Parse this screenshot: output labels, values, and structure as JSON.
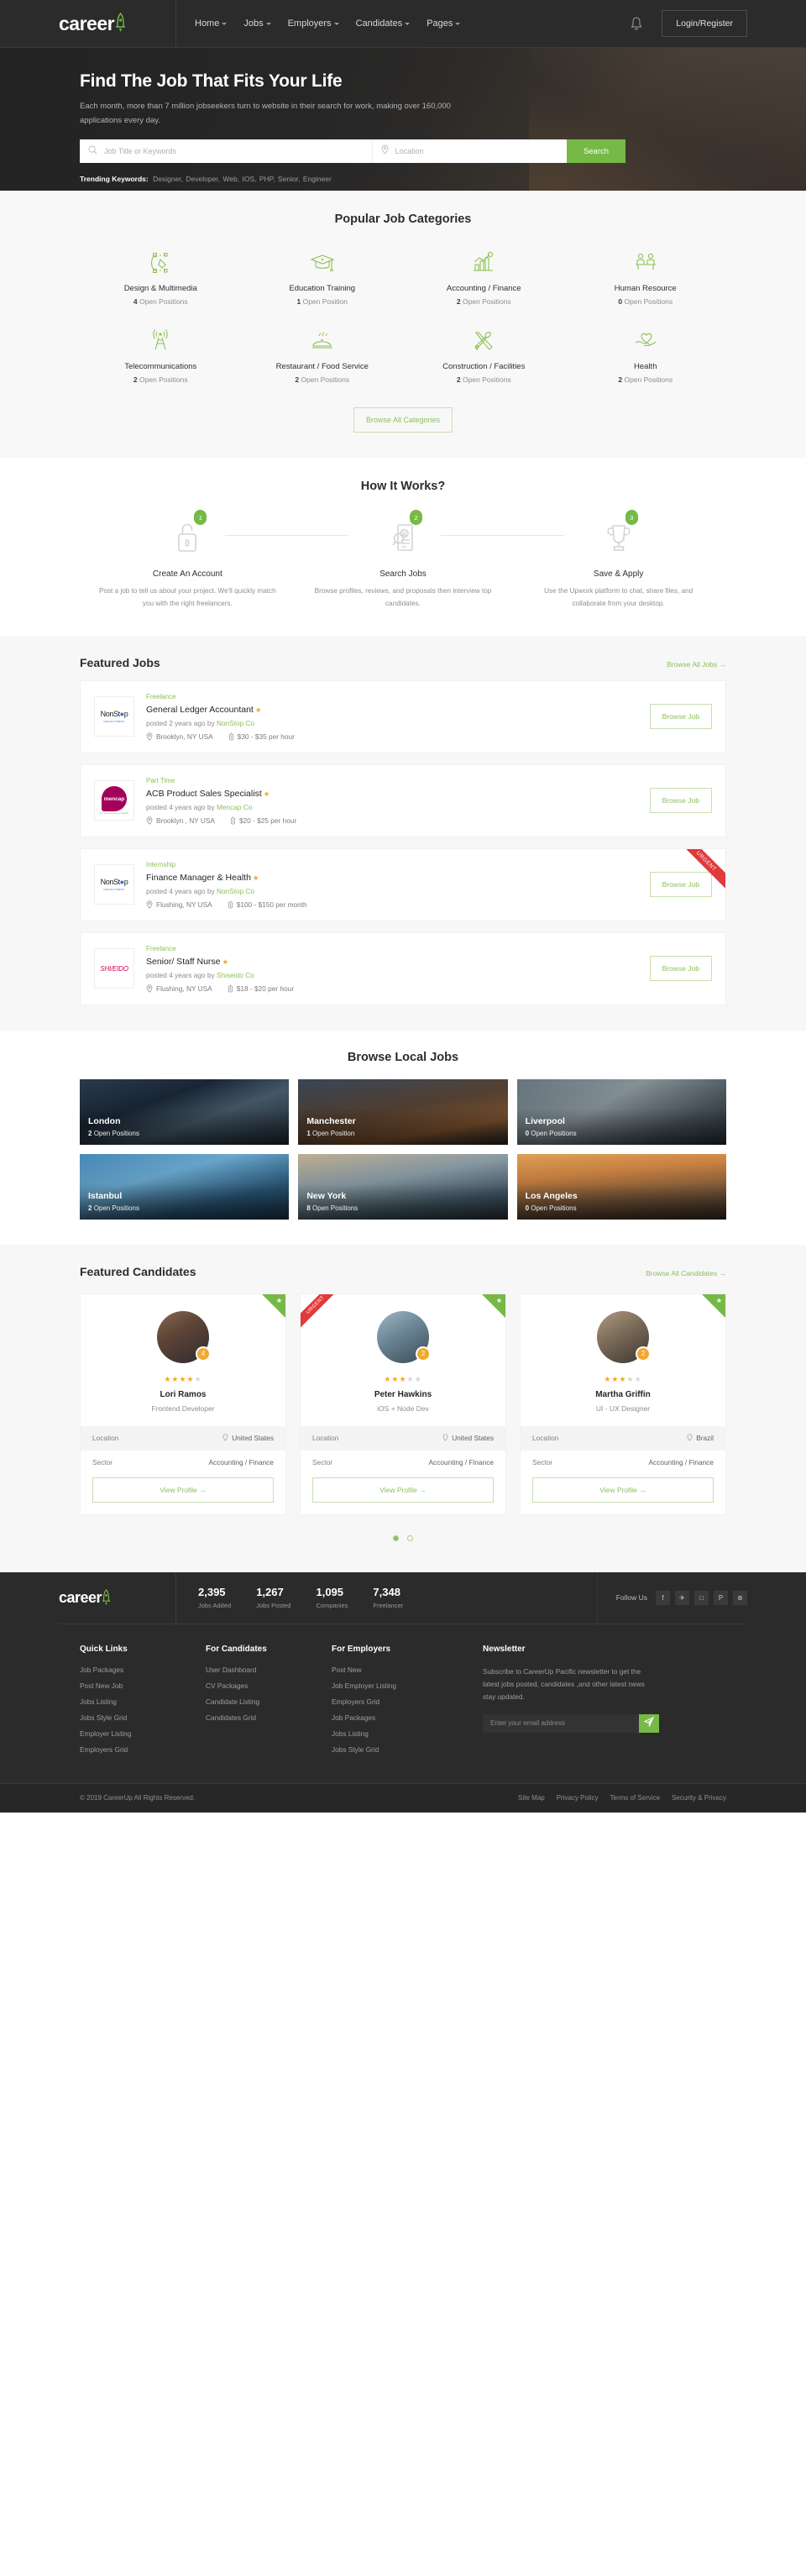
{
  "brand": {
    "name": "careerup",
    "name_part1": "career",
    "name_part2": "up"
  },
  "header": {
    "nav": [
      {
        "label": "Home",
        "has_caret": true
      },
      {
        "label": "Jobs",
        "has_caret": true
      },
      {
        "label": "Employers",
        "has_caret": true
      },
      {
        "label": "Candidates",
        "has_caret": true
      },
      {
        "label": "Pages",
        "has_caret": true
      }
    ],
    "notification_icon": "bell-icon",
    "login_label": "Login/Register"
  },
  "hero": {
    "title": "Find The Job That Fits Your Life",
    "subtitle": "Each month, more than 7 million jobseekers turn to website in their search for work, making over 160,000 applications every day.",
    "keyword_placeholder": "Job Title or Keywords",
    "location_placeholder": "Location",
    "search_label": "Search",
    "trending_label": "Trending Keywords:",
    "trending": [
      "Designer,",
      "Developer,",
      "Web,",
      "IOS,",
      "PHP,",
      "Senior,",
      "Engineer"
    ]
  },
  "categories": {
    "title": "Popular Job Categories",
    "browse_label": "Browse All Categories",
    "items": [
      {
        "name": "Design & Multimedia",
        "count": "4",
        "count_label": "Open Positions",
        "icon": "pen-tool-icon"
      },
      {
        "name": "Education Training",
        "count": "1",
        "count_label": "Open Position",
        "icon": "graduation-cap-icon"
      },
      {
        "name": "Accounting / Finance",
        "count": "2",
        "count_label": "Open Positions",
        "icon": "bar-chart-icon"
      },
      {
        "name": "Human Resource",
        "count": "0",
        "count_label": "Open Positions",
        "icon": "people-desk-icon"
      },
      {
        "name": "Telecommunications",
        "count": "2",
        "count_label": "Open Positions",
        "icon": "antenna-tower-icon"
      },
      {
        "name": "Restaurant / Food Service",
        "count": "2",
        "count_label": "Open Positions",
        "icon": "food-cloche-icon"
      },
      {
        "name": "Construction / Facilities",
        "count": "2",
        "count_label": "Open Positions",
        "icon": "tools-icon"
      },
      {
        "name": "Health",
        "count": "2",
        "count_label": "Open Positions",
        "icon": "hand-heart-icon"
      }
    ]
  },
  "how_it_works": {
    "title": "How It Works?",
    "steps": [
      {
        "num": "1",
        "name": "Create An Account",
        "desc": "Post a job to tell us about your project. We'll quickly match you with the right freelancers.",
        "icon": "lock-icon"
      },
      {
        "num": "2",
        "name": "Search Jobs",
        "desc": "Browse profiles, reviews, and proposals then interview top candidates.",
        "icon": "resume-search-icon"
      },
      {
        "num": "3",
        "name": "Save & Apply",
        "desc": "Use the Upwork platform to chat, share files, and collaborate from your desktop.",
        "icon": "trophy-icon"
      }
    ]
  },
  "featured_jobs": {
    "title": "Featured Jobs",
    "more_label": "Browse All Jobs",
    "browse_job_label": "Browse Job",
    "urgent_label": "URGENT",
    "items": [
      {
        "logo_text": "NonStop",
        "logo_sub": "RECRUITMENT",
        "type": "Freelance",
        "title": "General Ledger Accountant",
        "posted": "posted 2 years ago by",
        "company": "NonStop Co",
        "location": "Brooklyn, NY USA",
        "salary": "$30 - $35 per hour",
        "urgent": false,
        "featured": true
      },
      {
        "logo_text": "mencap",
        "logo_sub": "The voice of learning disability",
        "type": "Part Time",
        "title": "ACB Product Sales Specialist",
        "posted": "posted 4 years ago by",
        "company": "Mencap Co",
        "location": "Brooklyn , NY USA",
        "salary": "$20 - $25 per hour",
        "urgent": false,
        "featured": true
      },
      {
        "logo_text": "NonStop",
        "logo_sub": "RECRUITMENT",
        "type": "Internship",
        "title": "Finance Manager & Health",
        "posted": "posted 4 years ago by",
        "company": "NonStop Co",
        "location": "Flushing, NY USA",
        "salary": "$100 - $150 per month",
        "urgent": true,
        "featured": true
      },
      {
        "logo_text": "SHISEIDO",
        "logo_sub": "",
        "type": "Freelance",
        "title": "Senior/ Staff Nurse",
        "posted": "posted 4 years ago by",
        "company": "Shiseido Co",
        "location": "Flushing, NY USA",
        "salary": "$18 - $20 per hour",
        "urgent": false,
        "featured": true
      }
    ]
  },
  "local_jobs": {
    "title": "Browse Local Jobs",
    "items": [
      {
        "city": "London",
        "count": "2",
        "count_label": "Open Positions",
        "img": "img-london"
      },
      {
        "city": "Manchester",
        "count": "1",
        "count_label": "Open Position",
        "img": "img-manch"
      },
      {
        "city": "Liverpool",
        "count": "0",
        "count_label": "Open Positions",
        "img": "img-liver"
      },
      {
        "city": "Istanbul",
        "count": "2",
        "count_label": "Open Positions",
        "img": "img-istan"
      },
      {
        "city": "New York",
        "count": "8",
        "count_label": "Open Positions",
        "img": "img-ny"
      },
      {
        "city": "Los Angeles",
        "count": "0",
        "count_label": "Open Positions",
        "img": "img-la"
      }
    ]
  },
  "featured_candidates": {
    "title": "Featured Candidates",
    "more_label": "Browse All Candidates",
    "location_label": "Location",
    "sector_label": "Sector",
    "view_profile_label": "View Profile",
    "urgent_label": "URGENT",
    "items": [
      {
        "name": "Lori Ramos",
        "role": "Frontend Developer",
        "rank": "4",
        "stars": 4,
        "location": "United States",
        "sector": "Accounting / Finance",
        "badge": "star",
        "avatar": "av1"
      },
      {
        "name": "Peter Hawkins",
        "role": "iOS + Node Dev",
        "rank": "2",
        "stars": 3,
        "location": "United States",
        "sector": "Accounting / Finance",
        "badge": "urgent-and-star",
        "avatar": "av2"
      },
      {
        "name": "Martha Griffin",
        "role": "UI - UX Designer",
        "rank": "2",
        "stars": 3,
        "location": "Brazil",
        "sector": "Accounting / Finance",
        "badge": "star",
        "avatar": "av3"
      }
    ]
  },
  "stats": {
    "items": [
      {
        "num": "2,395",
        "label": "Jobs Added"
      },
      {
        "num": "1,267",
        "label": "Jobs Posted"
      },
      {
        "num": "1,095",
        "label": "Companies"
      },
      {
        "num": "7,348",
        "label": "Freelancer"
      }
    ],
    "follow_label": "Follow Us",
    "socials": [
      {
        "icon": "facebook-icon",
        "glyph": "f"
      },
      {
        "icon": "twitter-icon",
        "glyph": "✈"
      },
      {
        "icon": "instagram-icon",
        "glyph": "□"
      },
      {
        "icon": "pinterest-icon",
        "glyph": "P"
      },
      {
        "icon": "dribbble-icon",
        "glyph": "⊛"
      }
    ]
  },
  "footer": {
    "columns": [
      {
        "heading": "Quick Links",
        "links": [
          "Job Packages",
          "Post New Job",
          "Jobs Listing",
          "Jobs Style Grid",
          "Employer Listing",
          "Employers Grid"
        ]
      },
      {
        "heading": "For Candidates",
        "links": [
          "User Dashboard",
          "CV Packages",
          "Candidate Listing",
          "Candidates Grid"
        ]
      },
      {
        "heading": "For Employers",
        "links": [
          "Post New",
          "Job Employer Listing",
          "Employers Grid",
          "Job Packages",
          "Jobs Listing",
          "Jobs Style Grid"
        ]
      }
    ],
    "newsletter": {
      "heading": "Newsletter",
      "text": "Subscribe to CareerUp Pacific newsletter to get the latest jobs posted, candidates ,and other latest news stay updated.",
      "placeholder": "Enter your email address",
      "submit_icon": "paper-plane-icon"
    },
    "copyright": "© 2019 CareerUp All Rights Reserved.",
    "bottom_links": [
      "Site Map",
      "Privacy Policy",
      "Terms of Service",
      "Security & Privacy"
    ]
  },
  "colors": {
    "accent": "#76b947",
    "accent_light": "#8cbf5c",
    "dark": "#2b2b2b",
    "star": "#f5a623",
    "urgent": "#e03a3a"
  }
}
